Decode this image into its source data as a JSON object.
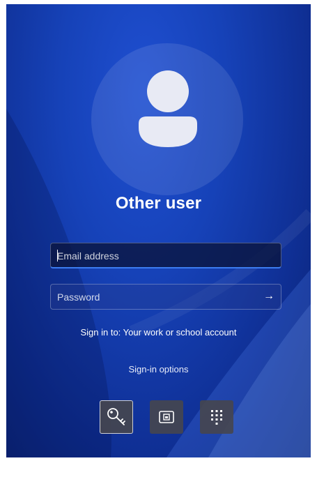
{
  "user": {
    "name": "Other user"
  },
  "email_field": {
    "placeholder": "Email address",
    "value": ""
  },
  "password_field": {
    "placeholder": "Password",
    "value": "",
    "submit_icon": "arrow-right-icon"
  },
  "signin_to": "Sign in to: Your work or school account",
  "signin_options": {
    "label": "Sign-in options",
    "items": [
      {
        "icon": "key-icon",
        "selected": true
      },
      {
        "icon": "mobile-device-icon",
        "selected": false
      },
      {
        "icon": "pin-keypad-icon",
        "selected": false
      }
    ]
  },
  "colors": {
    "background": "#1642b8",
    "accent": "#3c7cf0",
    "text": "#ffffff"
  }
}
